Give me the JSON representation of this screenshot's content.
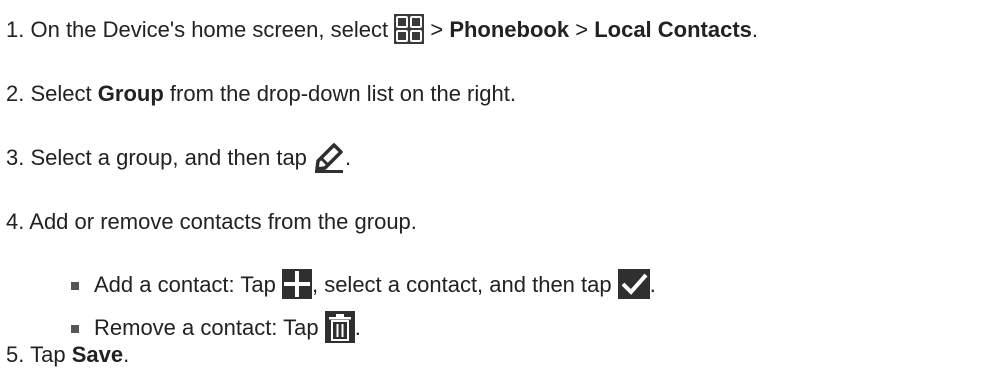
{
  "steps": [
    {
      "number": "1.",
      "parts": {
        "pre": "On the Device's home screen, select",
        "sep1": ">",
        "b1": "Phonebook",
        "sep2": ">",
        "b2": "Local Contacts",
        "end": "."
      },
      "icon": "apps-grid-icon"
    },
    {
      "number": "2.",
      "parts": {
        "pre": "Select",
        "b1": "Group",
        "post": "from the drop-down list on the right."
      }
    },
    {
      "number": "3.",
      "parts": {
        "pre": "Select a group, and then tap",
        "end": "."
      },
      "icon": "edit-pencil-icon"
    },
    {
      "number": "4.",
      "parts": {
        "text": "Add or remove contacts from the group."
      },
      "bullets": [
        {
          "pre": "Add a contact: Tap",
          "mid": ", select a contact, and then tap",
          "end": ".",
          "icons": [
            "add-plus-icon",
            "check-icon"
          ]
        },
        {
          "pre": "Remove a contact: Tap",
          "end": ".",
          "icons": [
            "trash-icon"
          ]
        }
      ]
    },
    {
      "number": "5.",
      "parts": {
        "pre": "Tap",
        "b1": "Save",
        "end": "."
      }
    }
  ],
  "colors": {
    "text": "#222222",
    "icon_fill": "#2f2f2f",
    "icon_grid": "#3a3a3a",
    "icon_grid_cell_border": "#ffffff"
  }
}
